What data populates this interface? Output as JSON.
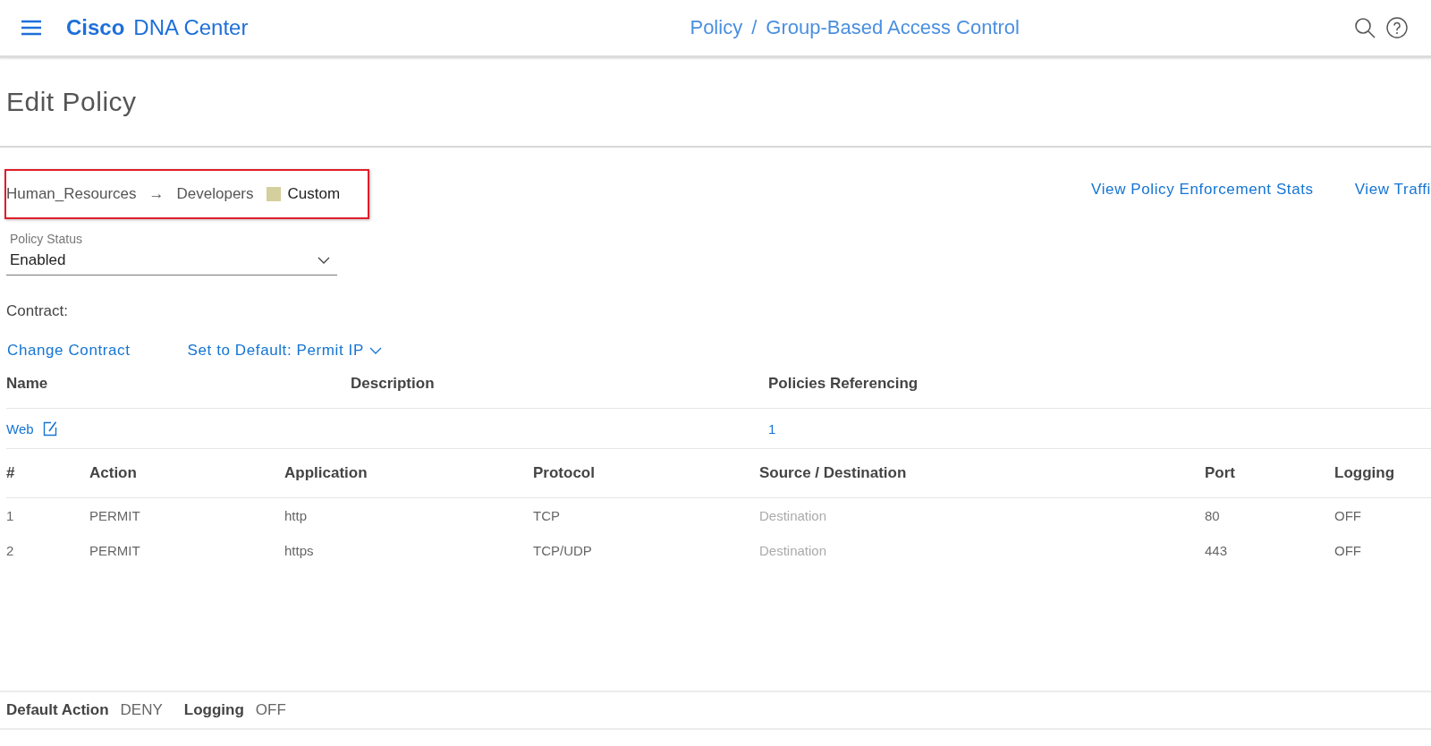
{
  "header": {
    "brand_bold": "Cisco",
    "brand": "DNA Center",
    "breadcrumb": [
      "Policy",
      "Group-Based Access Control"
    ],
    "separator": "/"
  },
  "page_title": "Edit Policy",
  "policy": {
    "source": "Human_Resources",
    "arrow": "→",
    "destination": "Developers",
    "tag": {
      "label": "Custom",
      "color": "#d4cf9c"
    }
  },
  "links": [
    "View Policy Enforcement Stats",
    "View Traffi"
  ],
  "policy_status": {
    "label": "Policy Status",
    "value": "Enabled"
  },
  "contract": {
    "label": "Contract:",
    "change_link": "Change Contract",
    "default_link": "Set to Default: Permit IP",
    "columns": [
      "Name",
      "Description",
      "Policies Referencing"
    ],
    "rows": [
      {
        "name": "Web",
        "description": "",
        "references": "1"
      }
    ]
  },
  "rules": {
    "columns": [
      "#",
      "Action",
      "Application",
      "Protocol",
      "Source / Destination",
      "Port",
      "Logging"
    ],
    "rows": [
      [
        "1",
        "PERMIT",
        "http",
        "TCP",
        "Destination",
        "80",
        "OFF"
      ],
      [
        "2",
        "PERMIT",
        "https",
        "TCP/UDP",
        "Destination",
        "443",
        "OFF"
      ]
    ]
  },
  "footer": [
    {
      "label": "Default Action",
      "value": "DENY"
    },
    {
      "label": "Logging",
      "value": "OFF"
    }
  ]
}
